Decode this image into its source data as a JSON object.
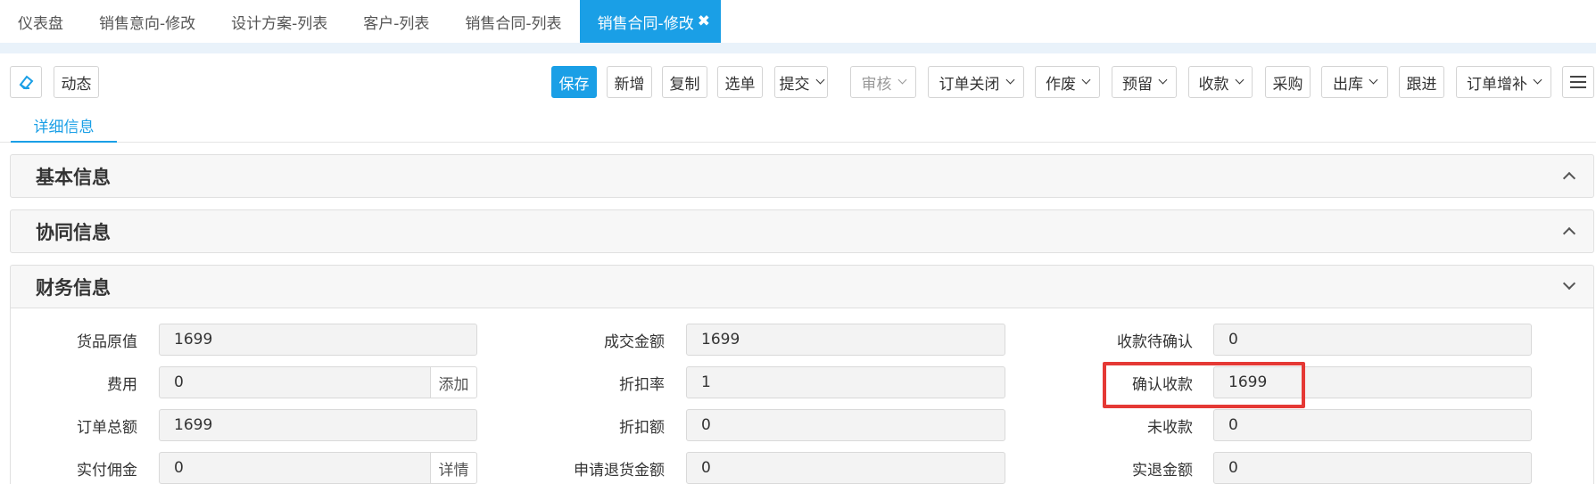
{
  "tabs": [
    {
      "label": "仪表盘"
    },
    {
      "label": "销售意向-修改"
    },
    {
      "label": "设计方案-列表"
    },
    {
      "label": "客户-列表"
    },
    {
      "label": "销售合同-列表"
    },
    {
      "label": "销售合同-修改",
      "active": true
    }
  ],
  "toolbar": {
    "dynamic": "动态",
    "save": "保存",
    "add": "新增",
    "copy": "复制",
    "select": "选单",
    "submit": "提交",
    "audit": "审核",
    "order_close": "订单关闭",
    "void": "作废",
    "reserve": "预留",
    "receipt": "收款",
    "purchase": "采购",
    "outbound": "出库",
    "follow": "跟进",
    "order_supplement": "订单增补"
  },
  "subtab": "详细信息",
  "sections": {
    "basic": "基本信息",
    "collab": "协同信息",
    "finance": "财务信息"
  },
  "finance": {
    "goods_original_label": "货品原值",
    "goods_original": "1699",
    "fee_label": "费用",
    "fee": "0",
    "fee_action": "添加",
    "order_total_label": "订单总额",
    "order_total": "1699",
    "commission_label": "实付佣金",
    "commission": "0",
    "commission_action": "详情",
    "deal_amount_label": "成交金额",
    "deal_amount": "1699",
    "discount_rate_label": "折扣率",
    "discount_rate": "1",
    "discount_amount_label": "折扣额",
    "discount_amount": "0",
    "return_request_label": "申请退货金额",
    "return_request": "0",
    "pending_receipt_label": "收款待确认",
    "pending_receipt": "0",
    "confirmed_receipt_label": "确认收款",
    "confirmed_receipt": "1699",
    "unreceived_label": "未收款",
    "unreceived": "0",
    "refund_label": "实退金额",
    "refund": "0"
  },
  "colors": {
    "accent": "#1a9fe6",
    "highlight": "#e53935"
  }
}
